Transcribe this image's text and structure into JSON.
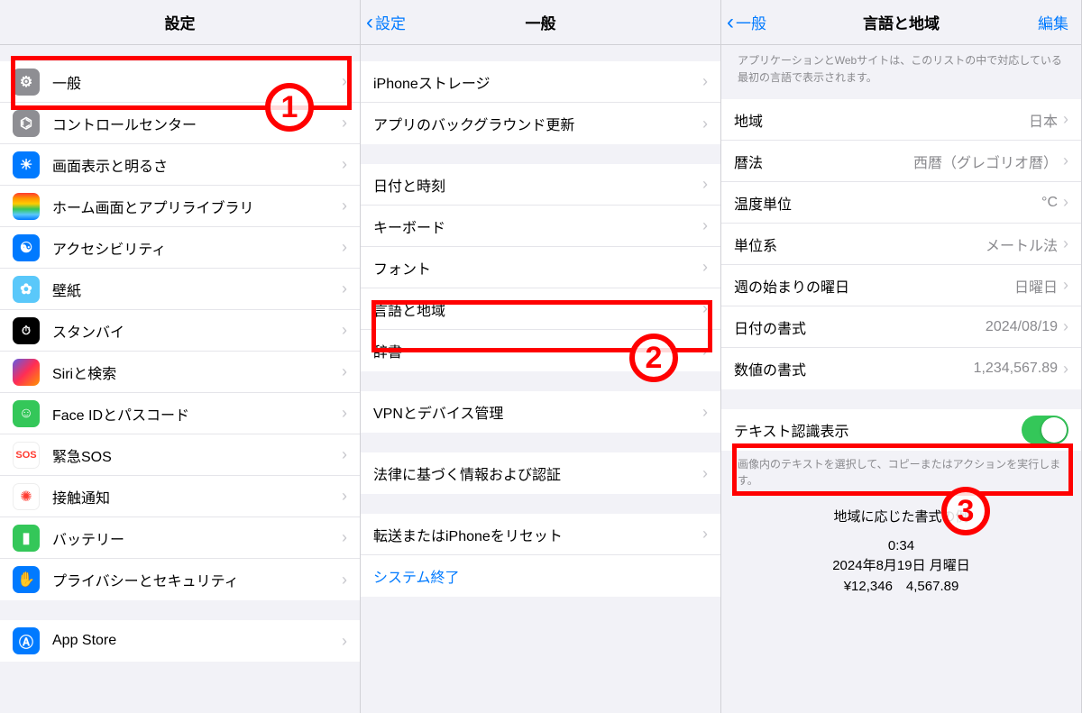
{
  "panel1": {
    "title": "設定",
    "items": [
      {
        "label": "一般"
      },
      {
        "label": "コントロールセンター"
      },
      {
        "label": "画面表示と明るさ"
      },
      {
        "label": "ホーム画面とアプリライブラリ"
      },
      {
        "label": "アクセシビリティ"
      },
      {
        "label": "壁紙"
      },
      {
        "label": "スタンバイ"
      },
      {
        "label": "Siriと検索"
      },
      {
        "label": "Face IDとパスコード"
      },
      {
        "label": "緊急SOS"
      },
      {
        "label": "接触通知"
      },
      {
        "label": "バッテリー"
      },
      {
        "label": "プライバシーとセキュリティ"
      }
    ],
    "items2": [
      {
        "label": "App Store"
      }
    ]
  },
  "panel2": {
    "back": "設定",
    "title": "一般",
    "g1": [
      {
        "label": "iPhoneストレージ"
      },
      {
        "label": "アプリのバックグラウンド更新"
      }
    ],
    "g2": [
      {
        "label": "日付と時刻"
      },
      {
        "label": "キーボード"
      },
      {
        "label": "フォント"
      },
      {
        "label": "言語と地域"
      },
      {
        "label": "辞書"
      }
    ],
    "g3": [
      {
        "label": "VPNとデバイス管理"
      }
    ],
    "g4": [
      {
        "label": "法律に基づく情報および認証"
      }
    ],
    "g5": [
      {
        "label": "転送またはiPhoneをリセット"
      },
      {
        "label": "システム終了"
      }
    ]
  },
  "panel3": {
    "back": "一般",
    "title": "言語と地域",
    "edit": "編集",
    "topnote": "アプリケーションとWebサイトは、このリストの中で対応している最初の言語で表示されます。",
    "rows": [
      {
        "label": "地域",
        "value": "日本"
      },
      {
        "label": "暦法",
        "value": "西暦（グレゴリオ暦）"
      },
      {
        "label": "温度単位",
        "value": "°C"
      },
      {
        "label": "単位系",
        "value": "メートル法"
      },
      {
        "label": "週の始まりの曜日",
        "value": "日曜日"
      },
      {
        "label": "日付の書式",
        "value": "2024/08/19"
      },
      {
        "label": "数値の書式",
        "value": "1,234,567.89"
      }
    ],
    "liveText": {
      "label": "テキスト認識表示"
    },
    "liveNote": "画像内のテキストを選択して、コピーまたはアクションを実行します。",
    "example": {
      "title": "地域に応じた書式の例",
      "time": "0:34",
      "date": "2024年8月19日 月曜日",
      "money": "¥12,346　4,567.89"
    }
  },
  "annotations": {
    "n1": "1",
    "n2": "2",
    "n3": "3"
  }
}
